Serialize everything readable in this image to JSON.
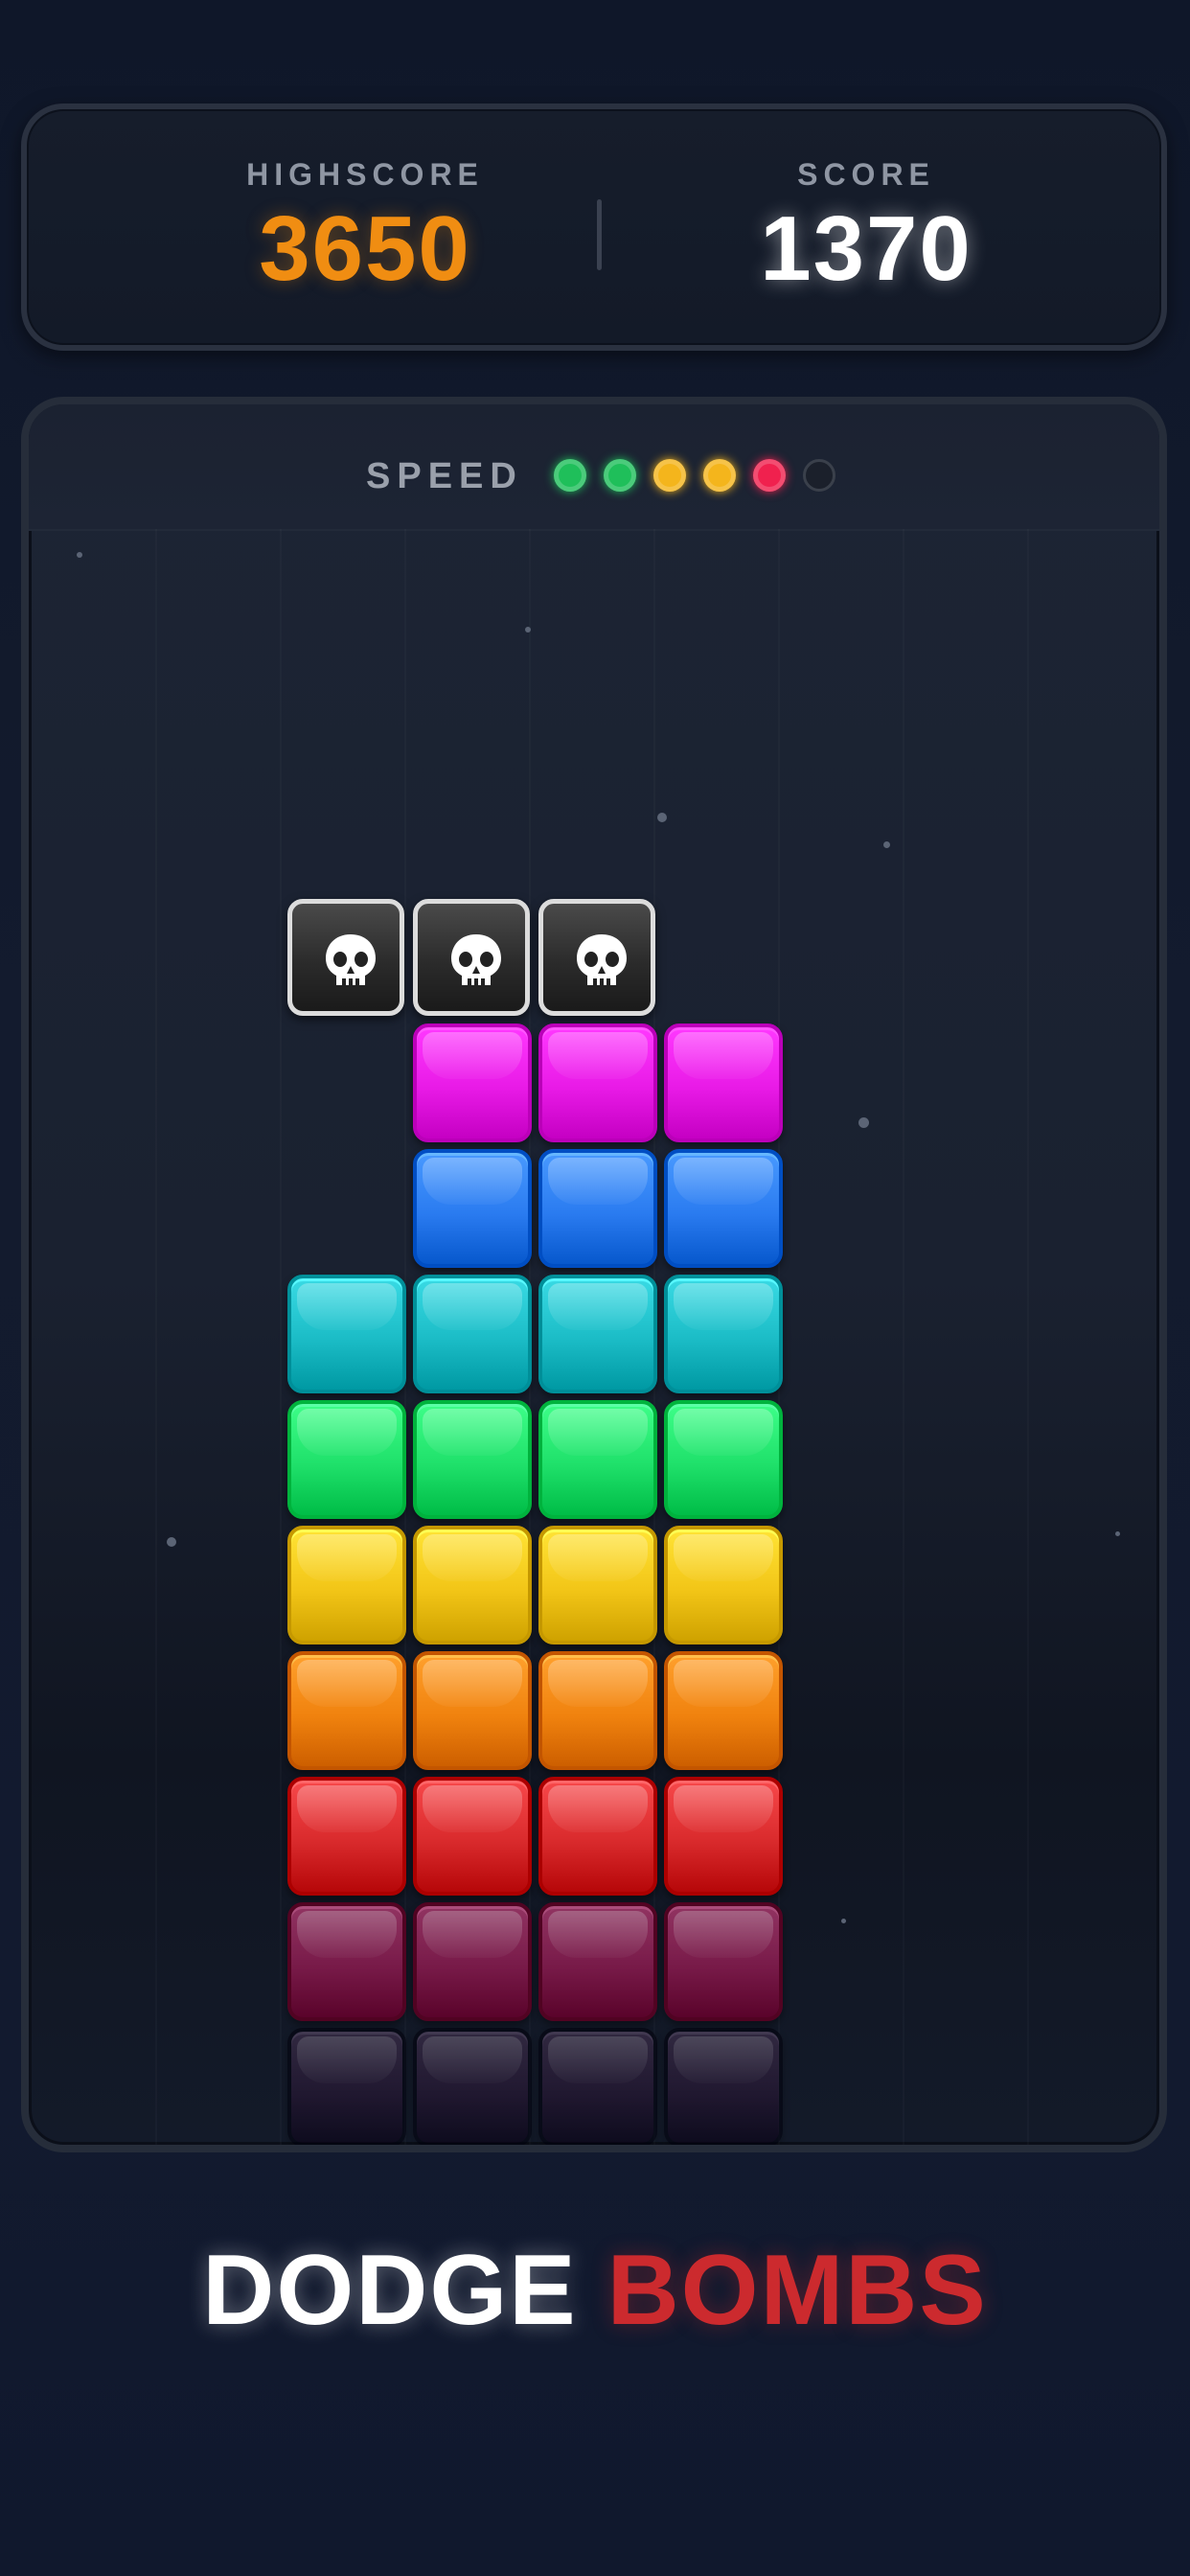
{
  "scoreboard": {
    "highscore_label": "HIGHSCORE",
    "highscore_value": "3650",
    "score_label": "SCORE",
    "score_value": "1370"
  },
  "speed": {
    "label": "SPEED",
    "level": 5,
    "max_level": 6,
    "dot_colors": [
      "#1fbf5a",
      "#1fbf5a",
      "#f4b51c",
      "#f4b51c",
      "#f0214e",
      "#2a303b"
    ]
  },
  "board": {
    "bomb_icon": "skull-icon",
    "bombs": [
      {
        "col": 0,
        "row": 0
      },
      {
        "col": 1,
        "row": 0
      },
      {
        "col": 2,
        "row": 0
      }
    ],
    "block_rows": [
      {
        "color": "magenta",
        "cols": [
          1,
          2,
          3
        ]
      },
      {
        "color": "blue",
        "cols": [
          1,
          2,
          3
        ]
      },
      {
        "color": "cyan",
        "cols": [
          0,
          1,
          2,
          3
        ]
      },
      {
        "color": "green",
        "cols": [
          0,
          1,
          2,
          3
        ]
      },
      {
        "color": "yellow",
        "cols": [
          0,
          1,
          2,
          3
        ]
      },
      {
        "color": "orange",
        "cols": [
          0,
          1,
          2,
          3
        ]
      },
      {
        "color": "red",
        "cols": [
          0,
          1,
          2,
          3
        ]
      },
      {
        "color": "crimson",
        "cols": [
          0,
          1,
          2,
          3
        ]
      },
      {
        "color": "purple",
        "cols": [
          0,
          1,
          2,
          3
        ]
      }
    ],
    "palette": {
      "magenta": "#e81ae6",
      "blue": "#2a7bf0",
      "cyan": "#1bbcc6",
      "green": "#1fe06a",
      "yellow": "#f2c517",
      "orange": "#f0820e",
      "red": "#d92a2c",
      "crimson": "#8a1b4f",
      "purple": "#2d1838"
    }
  },
  "tagline": {
    "word1": "DODGE",
    "word2": "BOMBS"
  }
}
